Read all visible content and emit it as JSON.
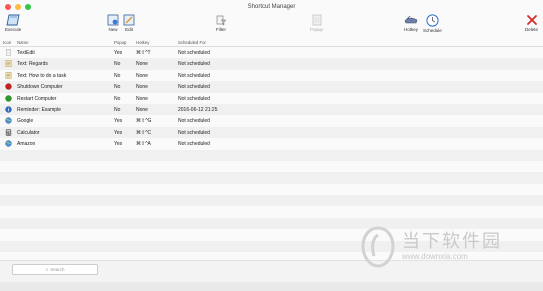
{
  "window": {
    "title": "Shortcut Manager",
    "traffic_lights": {
      "close": "#fc5753",
      "minimize": "#fdbc40",
      "zoom": "#33c748"
    }
  },
  "toolbar": {
    "execute_label": "Execute",
    "new_label": "New",
    "edit_label": "Edit",
    "filter_label": "Filter",
    "popup_label": "Popup",
    "hotkey_label": "Hotkey",
    "schedule_label": "Schedule",
    "delete_label": "Delete"
  },
  "table": {
    "headers": {
      "icon": "Icon",
      "name": "Name",
      "popup": "Popup",
      "hotkey": "Hotkey",
      "scheduled_for": "Scheduled For"
    },
    "rows": [
      {
        "icon": "document-icon",
        "name": "TextEdit",
        "popup": "Yes",
        "hotkey": "⌘⇧^T",
        "scheduled_for": "Not scheduled"
      },
      {
        "icon": "text-clipping-icon",
        "name": "Text: Regards",
        "popup": "No",
        "hotkey": "None",
        "scheduled_for": "Not scheduled"
      },
      {
        "icon": "text-clipping-icon",
        "name": "Text: How to do a task",
        "popup": "No",
        "hotkey": "None",
        "scheduled_for": "Not scheduled"
      },
      {
        "icon": "shutdown-icon",
        "name": "Shutdown Computer",
        "popup": "No",
        "hotkey": "None",
        "scheduled_for": "Not scheduled"
      },
      {
        "icon": "restart-icon",
        "name": "Restart Computer",
        "popup": "No",
        "hotkey": "None",
        "scheduled_for": "Not scheduled"
      },
      {
        "icon": "info-icon",
        "name": "Reminder: Example",
        "popup": "No",
        "hotkey": "None",
        "scheduled_for": "2016-06-12 21:25"
      },
      {
        "icon": "globe-icon",
        "name": "Google",
        "popup": "Yes",
        "hotkey": "⌘⇧^G",
        "scheduled_for": "Not scheduled"
      },
      {
        "icon": "calculator-icon",
        "name": "Calculator",
        "popup": "Yes",
        "hotkey": "⌘⇧^C",
        "scheduled_for": "Not scheduled"
      },
      {
        "icon": "globe-icon",
        "name": "Amazon",
        "popup": "Yes",
        "hotkey": "⌘⇧^A",
        "scheduled_for": "Not scheduled"
      }
    ]
  },
  "search": {
    "placeholder": "Search"
  },
  "watermark": {
    "text": "当下软件园",
    "url": "www.downxia.com"
  }
}
